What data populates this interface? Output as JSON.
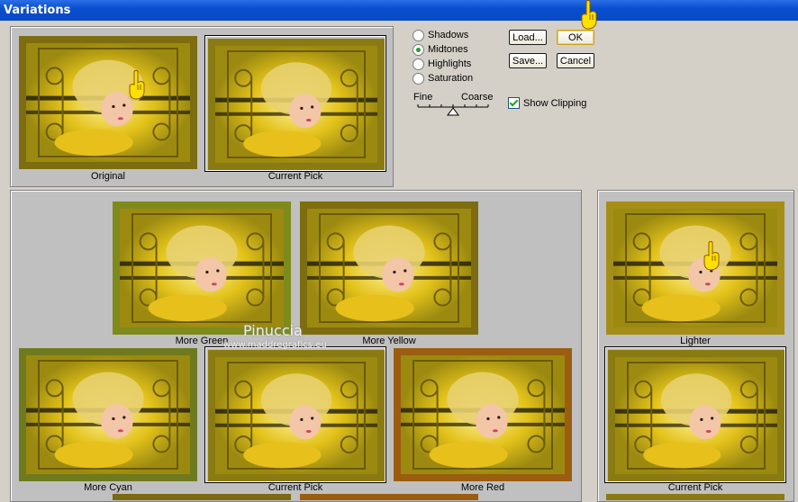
{
  "window": {
    "title": "Variations"
  },
  "tone": {
    "options": [
      "Shadows",
      "Midtones",
      "Highlights",
      "Saturation"
    ],
    "selected": "Midtones"
  },
  "buttons": {
    "load": "Load...",
    "save": "Save...",
    "ok": "OK",
    "cancel": "Cancel"
  },
  "slider": {
    "left": "Fine",
    "right": "Coarse"
  },
  "show_clipping": {
    "label": "Show Clipping",
    "checked": true
  },
  "top": {
    "original": "Original",
    "current": "Current Pick"
  },
  "grid": {
    "more_green": "More Green",
    "more_yellow": "More Yellow",
    "more_cyan": "More Cyan",
    "current": "Current Pick",
    "more_red": "More Red"
  },
  "right": {
    "lighter": "Lighter",
    "current": "Current Pick"
  },
  "watermark": {
    "name": "Pinuccia",
    "url": "www.maddregrafics.eu"
  },
  "colors": {
    "green": "#7e8a1c",
    "yellow": "#7d6d10",
    "cyan": "#6f7a1e",
    "red": "#9b5d0f",
    "lighter": "#a48e18",
    "base": "#8a7a12"
  }
}
